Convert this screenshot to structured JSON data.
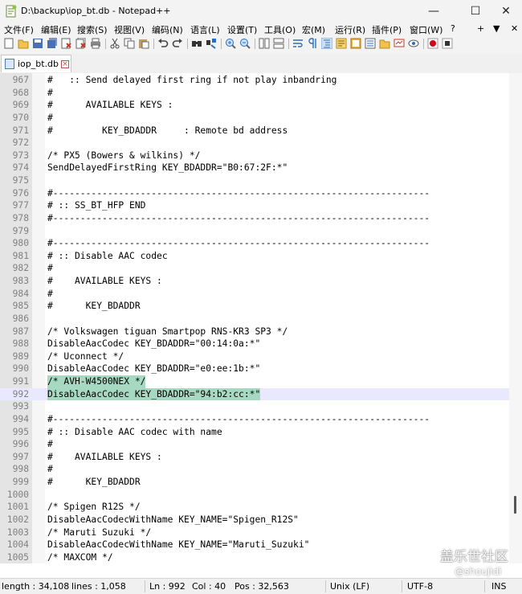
{
  "window": {
    "title": "D:\\backup\\iop_bt.db - Notepad++",
    "controls": {
      "minimize": "—",
      "maximize": "☐",
      "close": "✕"
    }
  },
  "menu": {
    "items": [
      "文件(F)",
      "编辑(E)",
      "搜索(S)",
      "视图(V)",
      "编码(N)",
      "语言(L)",
      "设置(T)",
      "工具(O)",
      "宏(M)",
      "运行(R)",
      "插件(P)",
      "窗口(W)",
      "?"
    ],
    "extras": [
      "+",
      "▼",
      "✕"
    ]
  },
  "tab": {
    "name": "iop_bt.db"
  },
  "editor": {
    "lines": [
      {
        "n": "967",
        "t": "#   :: Send delayed first ring if not play inbandring"
      },
      {
        "n": "968",
        "t": "#"
      },
      {
        "n": "969",
        "t": "#      AVAILABLE KEYS :"
      },
      {
        "n": "970",
        "t": "#"
      },
      {
        "n": "971",
        "t": "#         KEY_BDADDR     : Remote bd address"
      },
      {
        "n": "972",
        "t": ""
      },
      {
        "n": "973",
        "t": "/* PX5 (Bowers & wilkins) */"
      },
      {
        "n": "974",
        "t": "SendDelayedFirstRing KEY_BDADDR=\"B0:67:2F:*\""
      },
      {
        "n": "975",
        "t": ""
      },
      {
        "n": "976",
        "t": "#---------------------------------------------------------------------"
      },
      {
        "n": "977",
        "t": "# :: SS_BT_HFP END"
      },
      {
        "n": "978",
        "t": "#---------------------------------------------------------------------"
      },
      {
        "n": "979",
        "t": ""
      },
      {
        "n": "980",
        "t": "#---------------------------------------------------------------------"
      },
      {
        "n": "981",
        "t": "# :: Disable AAC codec"
      },
      {
        "n": "982",
        "t": "#"
      },
      {
        "n": "983",
        "t": "#    AVAILABLE KEYS :"
      },
      {
        "n": "984",
        "t": "#"
      },
      {
        "n": "985",
        "t": "#      KEY_BDADDR"
      },
      {
        "n": "986",
        "t": ""
      },
      {
        "n": "987",
        "t": "/* Volkswagen tiguan Smartpop RNS-KR3 SP3 */"
      },
      {
        "n": "988",
        "t": "DisableAacCodec KEY_BDADDR=\"00:14:0a:*\""
      },
      {
        "n": "989",
        "t": "/* Uconnect */"
      },
      {
        "n": "990",
        "t": "DisableAacCodec KEY_BDADDR=\"e0:ee:1b:*\""
      },
      {
        "n": "991",
        "t": "/* AVH-W4500NEX */",
        "selected": true
      },
      {
        "n": "992",
        "t": "DisableAacCodec KEY_BDADDR=\"94:b2:cc:*\"",
        "selected": true,
        "caret": true
      },
      {
        "n": "993",
        "t": ""
      },
      {
        "n": "994",
        "t": "#---------------------------------------------------------------------"
      },
      {
        "n": "995",
        "t": "# :: Disable AAC codec with name"
      },
      {
        "n": "996",
        "t": "#"
      },
      {
        "n": "997",
        "t": "#    AVAILABLE KEYS :"
      },
      {
        "n": "998",
        "t": "#"
      },
      {
        "n": "999",
        "t": "#      KEY_BDADDR"
      },
      {
        "n": "1000",
        "t": ""
      },
      {
        "n": "1001",
        "t": "/* Spigen R12S */"
      },
      {
        "n": "1002",
        "t": "DisableAacCodecWithName KEY_NAME=\"Spigen_R12S\""
      },
      {
        "n": "1003",
        "t": "/* Maruti Suzuki */"
      },
      {
        "n": "1004",
        "t": "DisableAacCodecWithName KEY_NAME=\"Maruti_Suzuki\""
      },
      {
        "n": "1005",
        "t": "/* MAXCOM */"
      }
    ]
  },
  "statusbar": {
    "length": "length : 34,108",
    "lines": "lines : 1,058",
    "ln": "Ln : 992",
    "col": "Col : 40",
    "pos": "Pos : 32,563",
    "eol": "Unix (LF)",
    "encoding": "UTF-8",
    "mode": "INS"
  },
  "watermark": {
    "main": "盖乐世社区",
    "sub": "@shoujidi"
  },
  "colors": {
    "selection": "#a6d8c2",
    "caret_line": "#e8e8ff",
    "gutter": "#e4e4e4"
  }
}
